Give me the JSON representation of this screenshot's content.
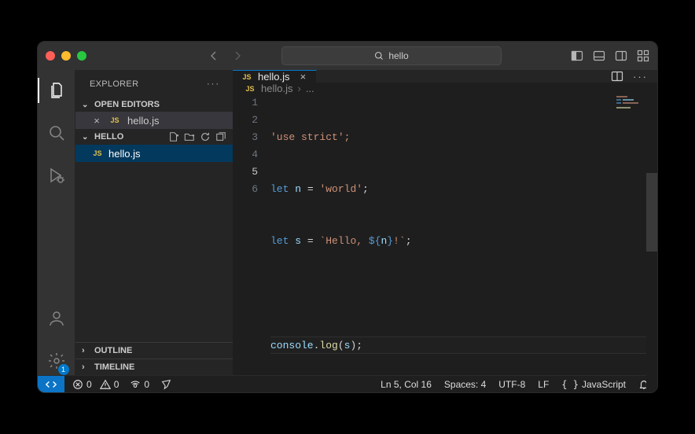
{
  "titlebar": {
    "search_value": "hello",
    "search_icon": "search-icon"
  },
  "activity": {
    "gear_badge": "1"
  },
  "sidebar": {
    "title": "EXPLORER",
    "open_editors_label": "OPEN EDITORS",
    "open_editors": [
      {
        "name": "hello.js"
      }
    ],
    "folder_label": "HELLO",
    "files": [
      {
        "name": "hello.js"
      }
    ],
    "outline_label": "OUTLINE",
    "timeline_label": "TIMELINE"
  },
  "editor": {
    "tab_name": "hello.js",
    "breadcrumb_file": "hello.js",
    "breadcrumb_rest": "...",
    "code": {
      "line1": "'use strict';",
      "line2_kw": "let",
      "line2_var": "n",
      "line2_eq": " = ",
      "line2_str": "'world'",
      "line2_semi": ";",
      "line3_kw": "let",
      "line3_var": "s",
      "line3_eq": " = ",
      "line3_tmpl_open": "`Hello, ",
      "line3_interp_open": "${",
      "line3_interp_var": "n",
      "line3_interp_close": "}",
      "line3_tmpl_close": "!`",
      "line3_semi": ";",
      "line5_obj": "console",
      "line5_dot": ".",
      "line5_call": "log",
      "line5_open": "(",
      "line5_arg": "s",
      "line5_close": ")",
      "line5_semi": ";"
    },
    "line_numbers": [
      "1",
      "2",
      "3",
      "4",
      "5",
      "6"
    ]
  },
  "status": {
    "errors": "0",
    "warnings": "0",
    "ports": "0",
    "cursor": "Ln 5, Col 16",
    "spaces": "Spaces: 4",
    "encoding": "UTF-8",
    "eol": "LF",
    "language": "JavaScript"
  }
}
